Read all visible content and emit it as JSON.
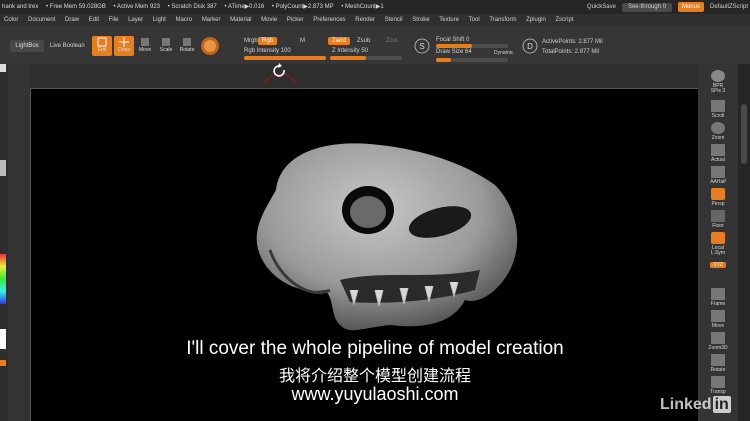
{
  "titlebar": {
    "stats": [
      "hank and trex",
      "• Free Mem 59.028GB",
      "• Active Mem 923",
      "• Scratch Disk 387",
      "• ATime▶0.016",
      "• PolyCount▶2.873 MP",
      "• MeshCount▶1"
    ],
    "quicksave": "QuickSave",
    "see_through": "See-through  0",
    "menus": "Menus",
    "default_zscript": "DefaultZScript"
  },
  "menubar": [
    "Color",
    "Document",
    "Draw",
    "Edit",
    "File",
    "Layer",
    "Light",
    "Macro",
    "Marker",
    "Material",
    "Movie",
    "Picker",
    "Preferences",
    "Render",
    "Stencil",
    "Stroke",
    "Texture",
    "Tool",
    "Transform",
    "Zplugin",
    "Zscript"
  ],
  "toolbar": {
    "lightbox": "LightBox",
    "live_boolean": "Live Boolean",
    "edit": "Edit",
    "draw": "Draw",
    "move": "Move",
    "scale": "Scale",
    "rotate": "Rotate",
    "mrgb": "Mrgb",
    "rgb": "Rgb",
    "m": "M",
    "rgb_intensity": "Rgb Intensity 100",
    "zadd": "Zadd",
    "zsub": "Zsub",
    "zcut": "Zcut",
    "z_intensity": "Z Intensity 50",
    "focal_shift": "Focal Shift 0",
    "draw_size": "Draw Size 64",
    "dynamic": "Dynamic",
    "active_points": "ActivePoints: 2.877 Mil",
    "total_points": "TotalPoints: 2.877 Mil",
    "rgb_intensity_value": 100,
    "z_intensity_value": 50,
    "draw_size_value": 64
  },
  "right_shelf": [
    "BPR",
    "SPix 3",
    "Scroll",
    "Zoom",
    "Actual",
    "AAHalf",
    "Persp",
    "Floor",
    "Local",
    "L.Sym",
    "XYZ",
    "Frame",
    "Move",
    "Zoom3D",
    "Rotate",
    "Transp"
  ],
  "subtitles": {
    "en": "I'll cover the whole pipeline of model creation",
    "zh": "我将介绍整个模型创建流程",
    "url": "www.yuyulaoshi.com"
  },
  "watermark": {
    "text": "Linked",
    "in": "in"
  },
  "colors": {
    "accent": "#e87d1e",
    "panel": "#363636",
    "canvas": "#000000",
    "model": "#a8a8a8"
  }
}
